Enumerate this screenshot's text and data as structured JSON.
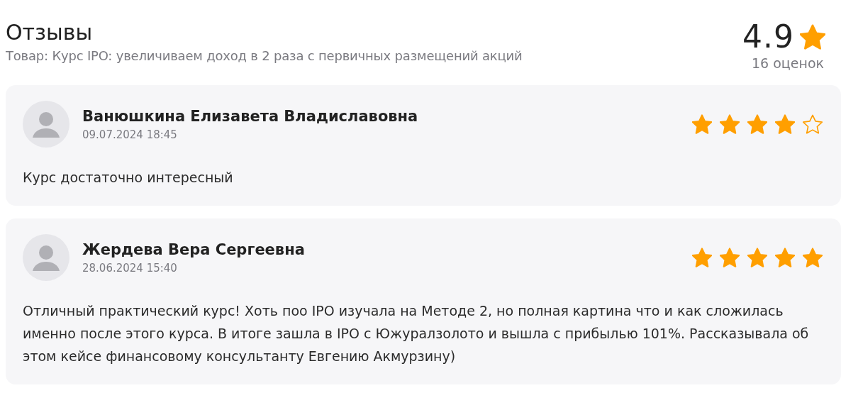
{
  "header": {
    "title": "Отзывы",
    "subtitle": "Товар: Курс IPO: увеличиваем доход в 2 раза с первичных размещений акций"
  },
  "summary": {
    "rating": "4.9",
    "count": "16 оценок"
  },
  "reviews": [
    {
      "author": "Ванюшкина Елизавета Владиславовна",
      "date": "09.07.2024 18:45",
      "stars": 4,
      "text": "Курс достаточно интересный"
    },
    {
      "author": "Жердева Вера Сергеевна",
      "date": "28.06.2024 15:40",
      "stars": 5,
      "text": "Отличный практический курс! Хоть поо IPO изучала на Методе 2, но полная картина что и как сложилась именно после этого курса. В итоге зашла в IPO с Южуралзолото и вышла с прибылью 101%. Рассказывала об этом кейсе финансовому консультанту Евгению Акмурзину)"
    }
  ]
}
